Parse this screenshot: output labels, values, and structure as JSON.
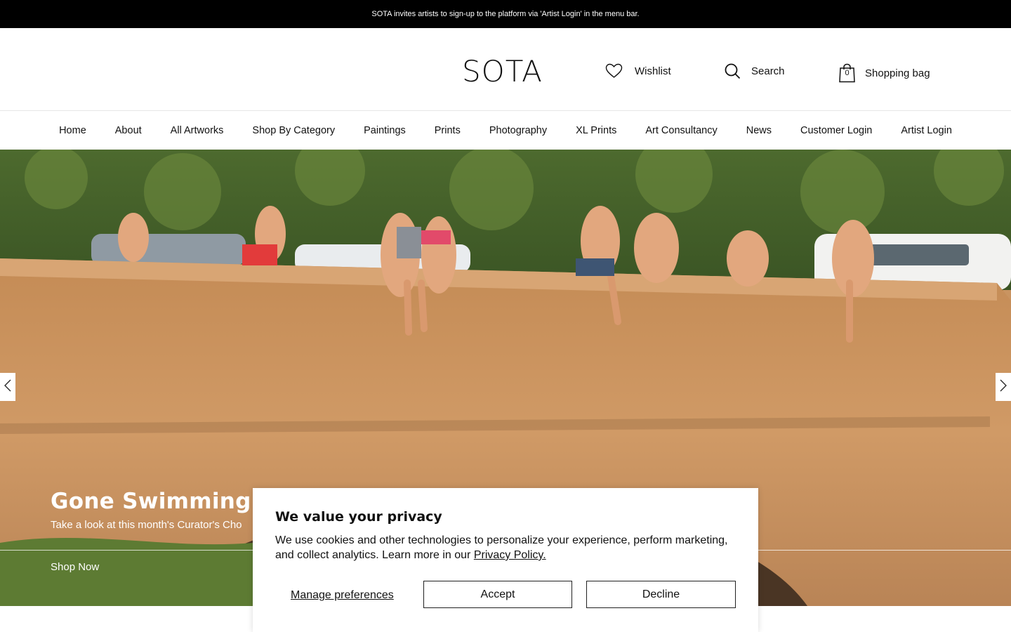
{
  "announcement": "SOTA invites artists to sign-up to the platform via 'Artist Login' in the menu bar.",
  "header": {
    "logo": "SOTA",
    "wishlist": "Wishlist",
    "search": "Search",
    "bag": "Shopping bag",
    "bag_count": "0"
  },
  "nav": [
    "Home",
    "About",
    "All Artworks",
    "Shop By Category",
    "Paintings",
    "Prints",
    "Photography",
    "XL Prints",
    "Art Consultancy",
    "News",
    "Customer Login",
    "Artist Login"
  ],
  "hero": {
    "title": "Gone Swimming",
    "subtitle": "Take a look at this month's Curator's Cho",
    "cta": "Shop Now"
  },
  "cookie": {
    "title": "We value your privacy",
    "text": "We use cookies and other technologies to personalize your experience, perform marketing, and collect analytics. Learn more in our ",
    "policy_link": "Privacy Policy.",
    "manage": "Manage preferences",
    "accept": "Accept",
    "decline": "Decline"
  },
  "colors": {
    "announcement_bg": "#000000",
    "hero_bridge": "#c99461",
    "foliage": "#3f5a2a"
  }
}
